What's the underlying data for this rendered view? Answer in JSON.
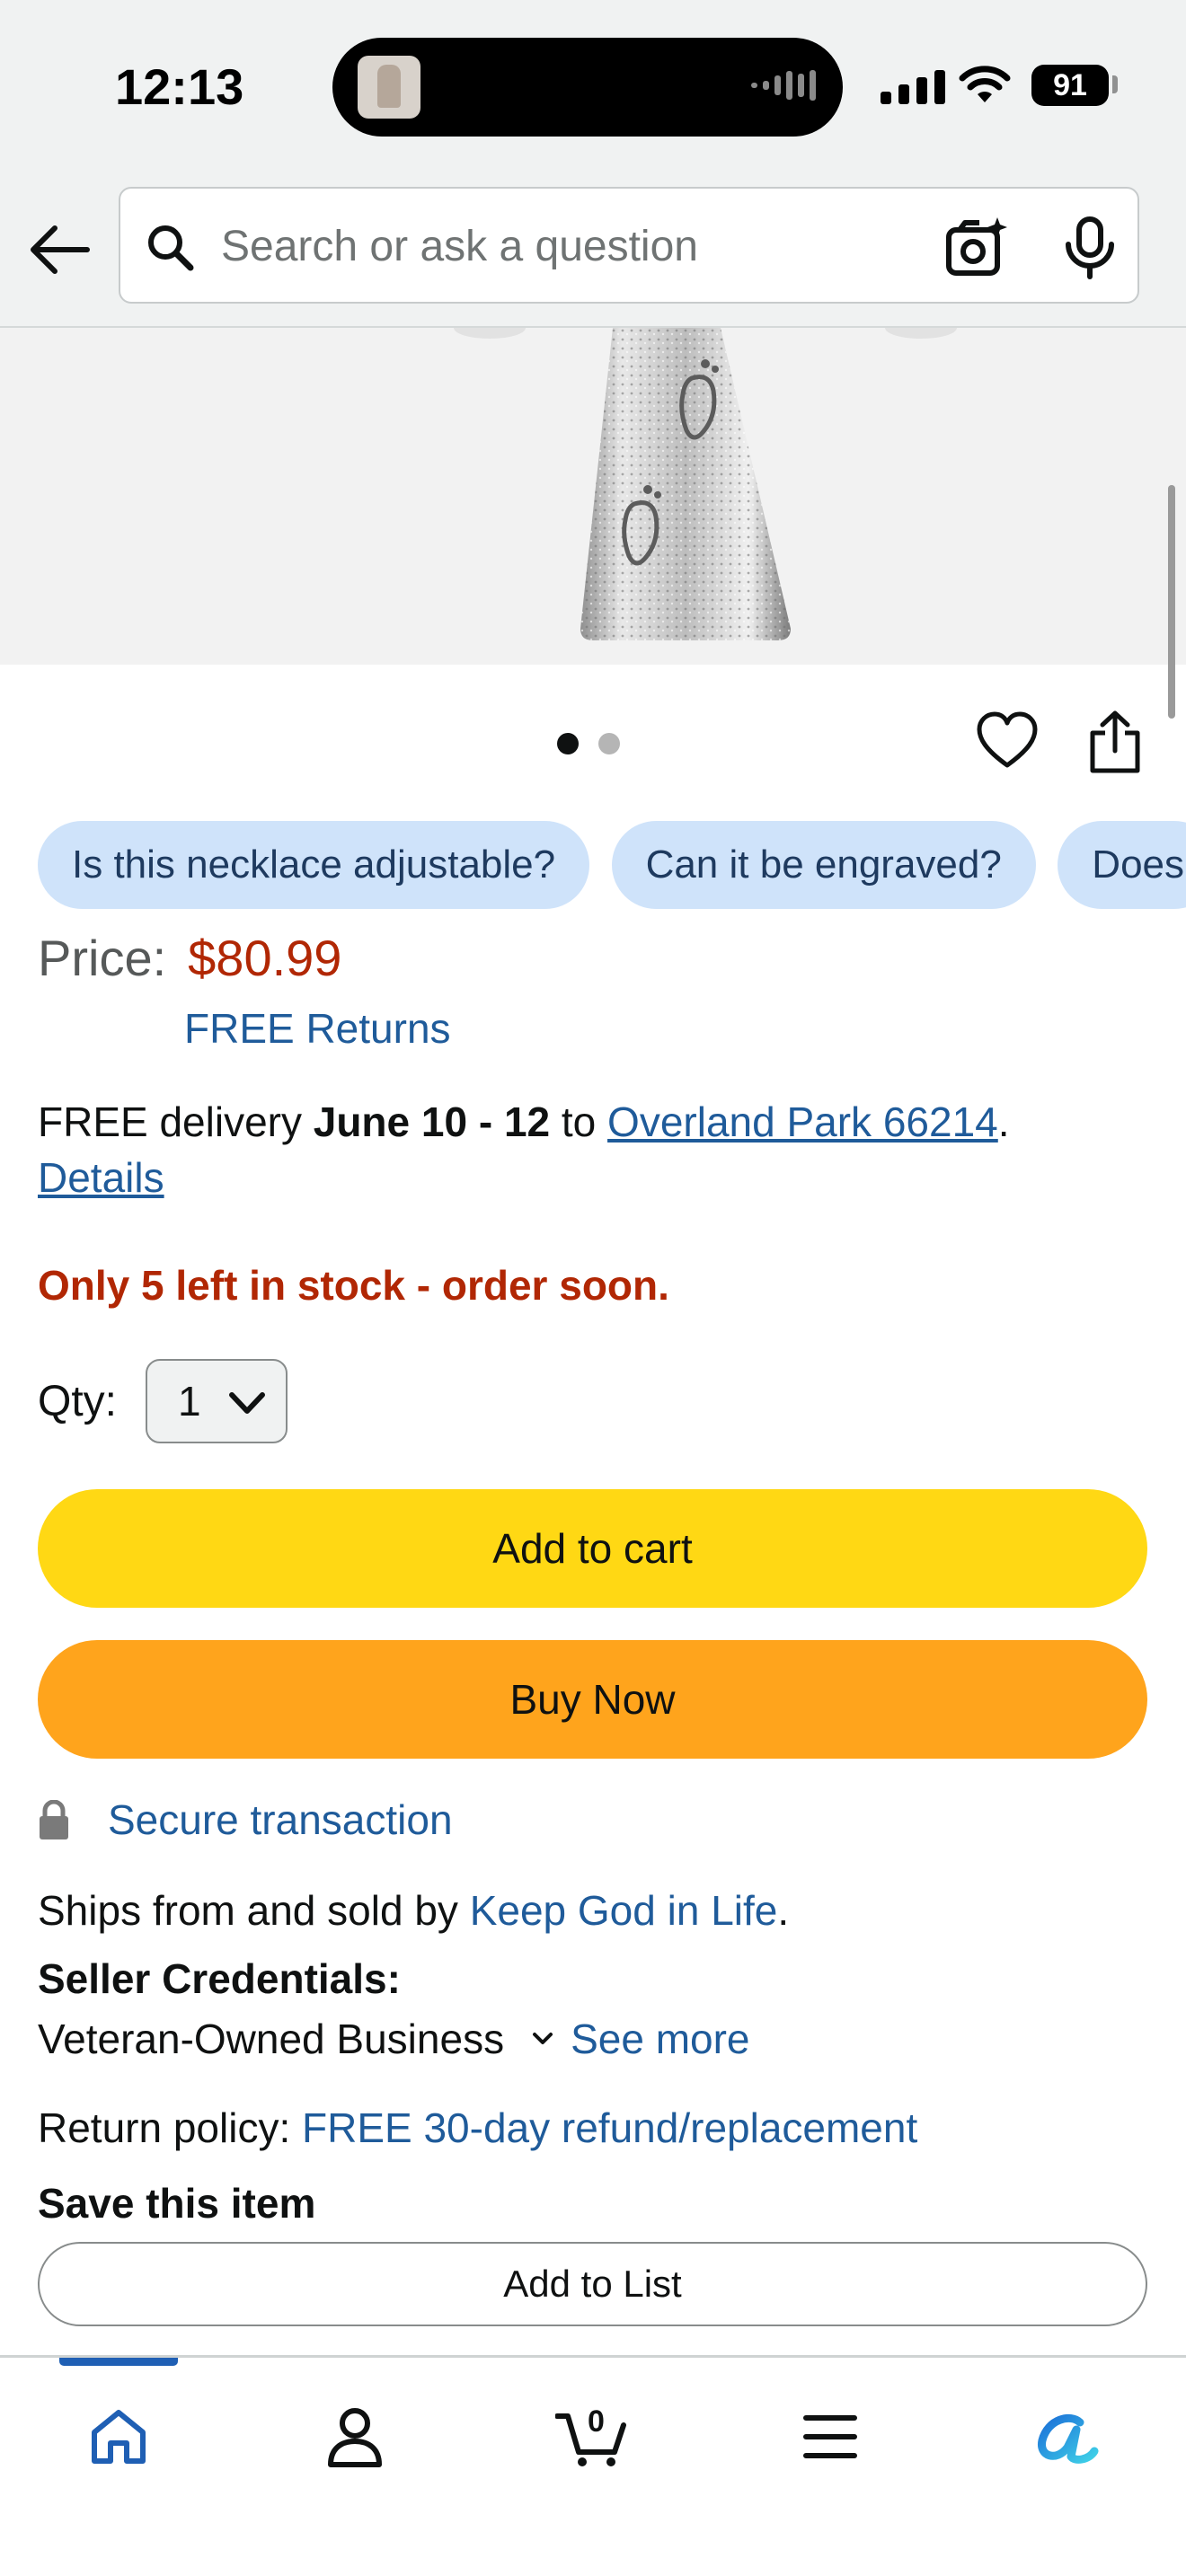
{
  "status_bar": {
    "time": "12:13",
    "battery": "91"
  },
  "search": {
    "placeholder": "Search or ask a question"
  },
  "product": {
    "image_index": 1,
    "image_count": 2
  },
  "questions": [
    "Is this necklace adjustable?",
    "Can it be engraved?",
    "Does"
  ],
  "price": {
    "label": "Price:",
    "value": "$80.99",
    "free_returns": "FREE Returns"
  },
  "delivery": {
    "prefix": "FREE delivery ",
    "dates": "June 10 - 12",
    "to": " to ",
    "location": "Overland Park 66214",
    "period": ".",
    "details": "Details"
  },
  "stock": "Only 5 left in stock - order soon.",
  "quantity": {
    "label": "Qty:",
    "value": "1"
  },
  "buttons": {
    "add_to_cart": "Add to cart",
    "buy_now": "Buy Now",
    "add_to_list": "Add to List"
  },
  "secure": "Secure transaction",
  "seller": {
    "ships_prefix": "Ships from and sold by ",
    "name": "Keep God in Life",
    "period": ".",
    "credentials_title": "Seller Credentials:",
    "credential": "Veteran-Owned Business",
    "see_more": "See more"
  },
  "return_policy": {
    "label": "Return policy: ",
    "value": "FREE 30-day refund/replacement"
  },
  "save_item": "Save this item",
  "bottom_nav": {
    "cart_count": "0",
    "active": "home"
  },
  "colors": {
    "price": "#b12704",
    "link": "#1f5b9a",
    "add_to_cart": "#ffd814",
    "buy_now": "#ffa41c",
    "chip": "#cfe3fa",
    "nav_active": "#1f5fb4"
  }
}
